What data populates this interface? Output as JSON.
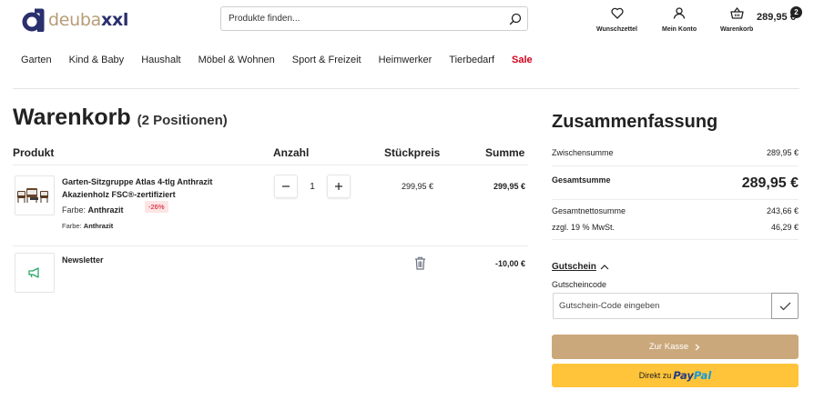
{
  "header": {
    "logo_part1": "deuba",
    "logo_part2": "xxl",
    "search_placeholder": "Produkte finden...",
    "wishlist_label": "Wunschzettel",
    "account_label": "Mein Konto",
    "cart_label": "Warenkorb",
    "cart_total": "289,95 €",
    "cart_count": "2"
  },
  "nav": {
    "items": [
      "Garten",
      "Kind & Baby",
      "Haushalt",
      "Möbel & Wohnen",
      "Sport & Freizeit",
      "Heimwerker",
      "Tierbedarf"
    ],
    "sale_label": "Sale",
    "sale_color": "#d0021b"
  },
  "cart": {
    "title": "Warenkorb",
    "count": "(2 Positionen)",
    "columns": {
      "product": "Produkt",
      "qty": "Anzahl",
      "unit_price": "Stückpreis",
      "sum": "Summe"
    },
    "items": [
      {
        "name": "Garten-Sitzgruppe Atlas 4-tlg Anthrazit Akazienholz FSC®-zertifiziert",
        "attr1_label": "Farbe:",
        "attr1_value": "Anthrazit",
        "attr2_label": "Farbe:",
        "attr2_value": "Anthrazit",
        "discount": "-26%",
        "quantity": "1",
        "unit_price": "299,95 €",
        "total": "299,95 €",
        "icon": "garden-furniture-set-image"
      },
      {
        "name": "Newsletter",
        "total": "-10,00 €",
        "icon": "megaphone-icon"
      }
    ]
  },
  "summary": {
    "title": "Zusammenfassung",
    "subtotal_label": "Zwischensumme",
    "subtotal_value": "289,95 €",
    "total_label": "Gesamtsumme",
    "total_value": "289,95 €",
    "net_label": "Gesamtnettosumme",
    "net_value": "243,66 €",
    "vat_label": "zzgl. 19 % MwSt.",
    "vat_value": "46,29 €",
    "voucher_toggle": "Gutschein",
    "voucher_label": "Gutscheincode",
    "voucher_placeholder": "Gutschein-Code eingeben",
    "checkout_label": "Zur Kasse",
    "paypal_prefix": "Direkt zu",
    "paypal_word1": "Pay",
    "paypal_word2": "Pal",
    "checkout_color": "#cba87b",
    "paypal_color": "#ffc439"
  }
}
